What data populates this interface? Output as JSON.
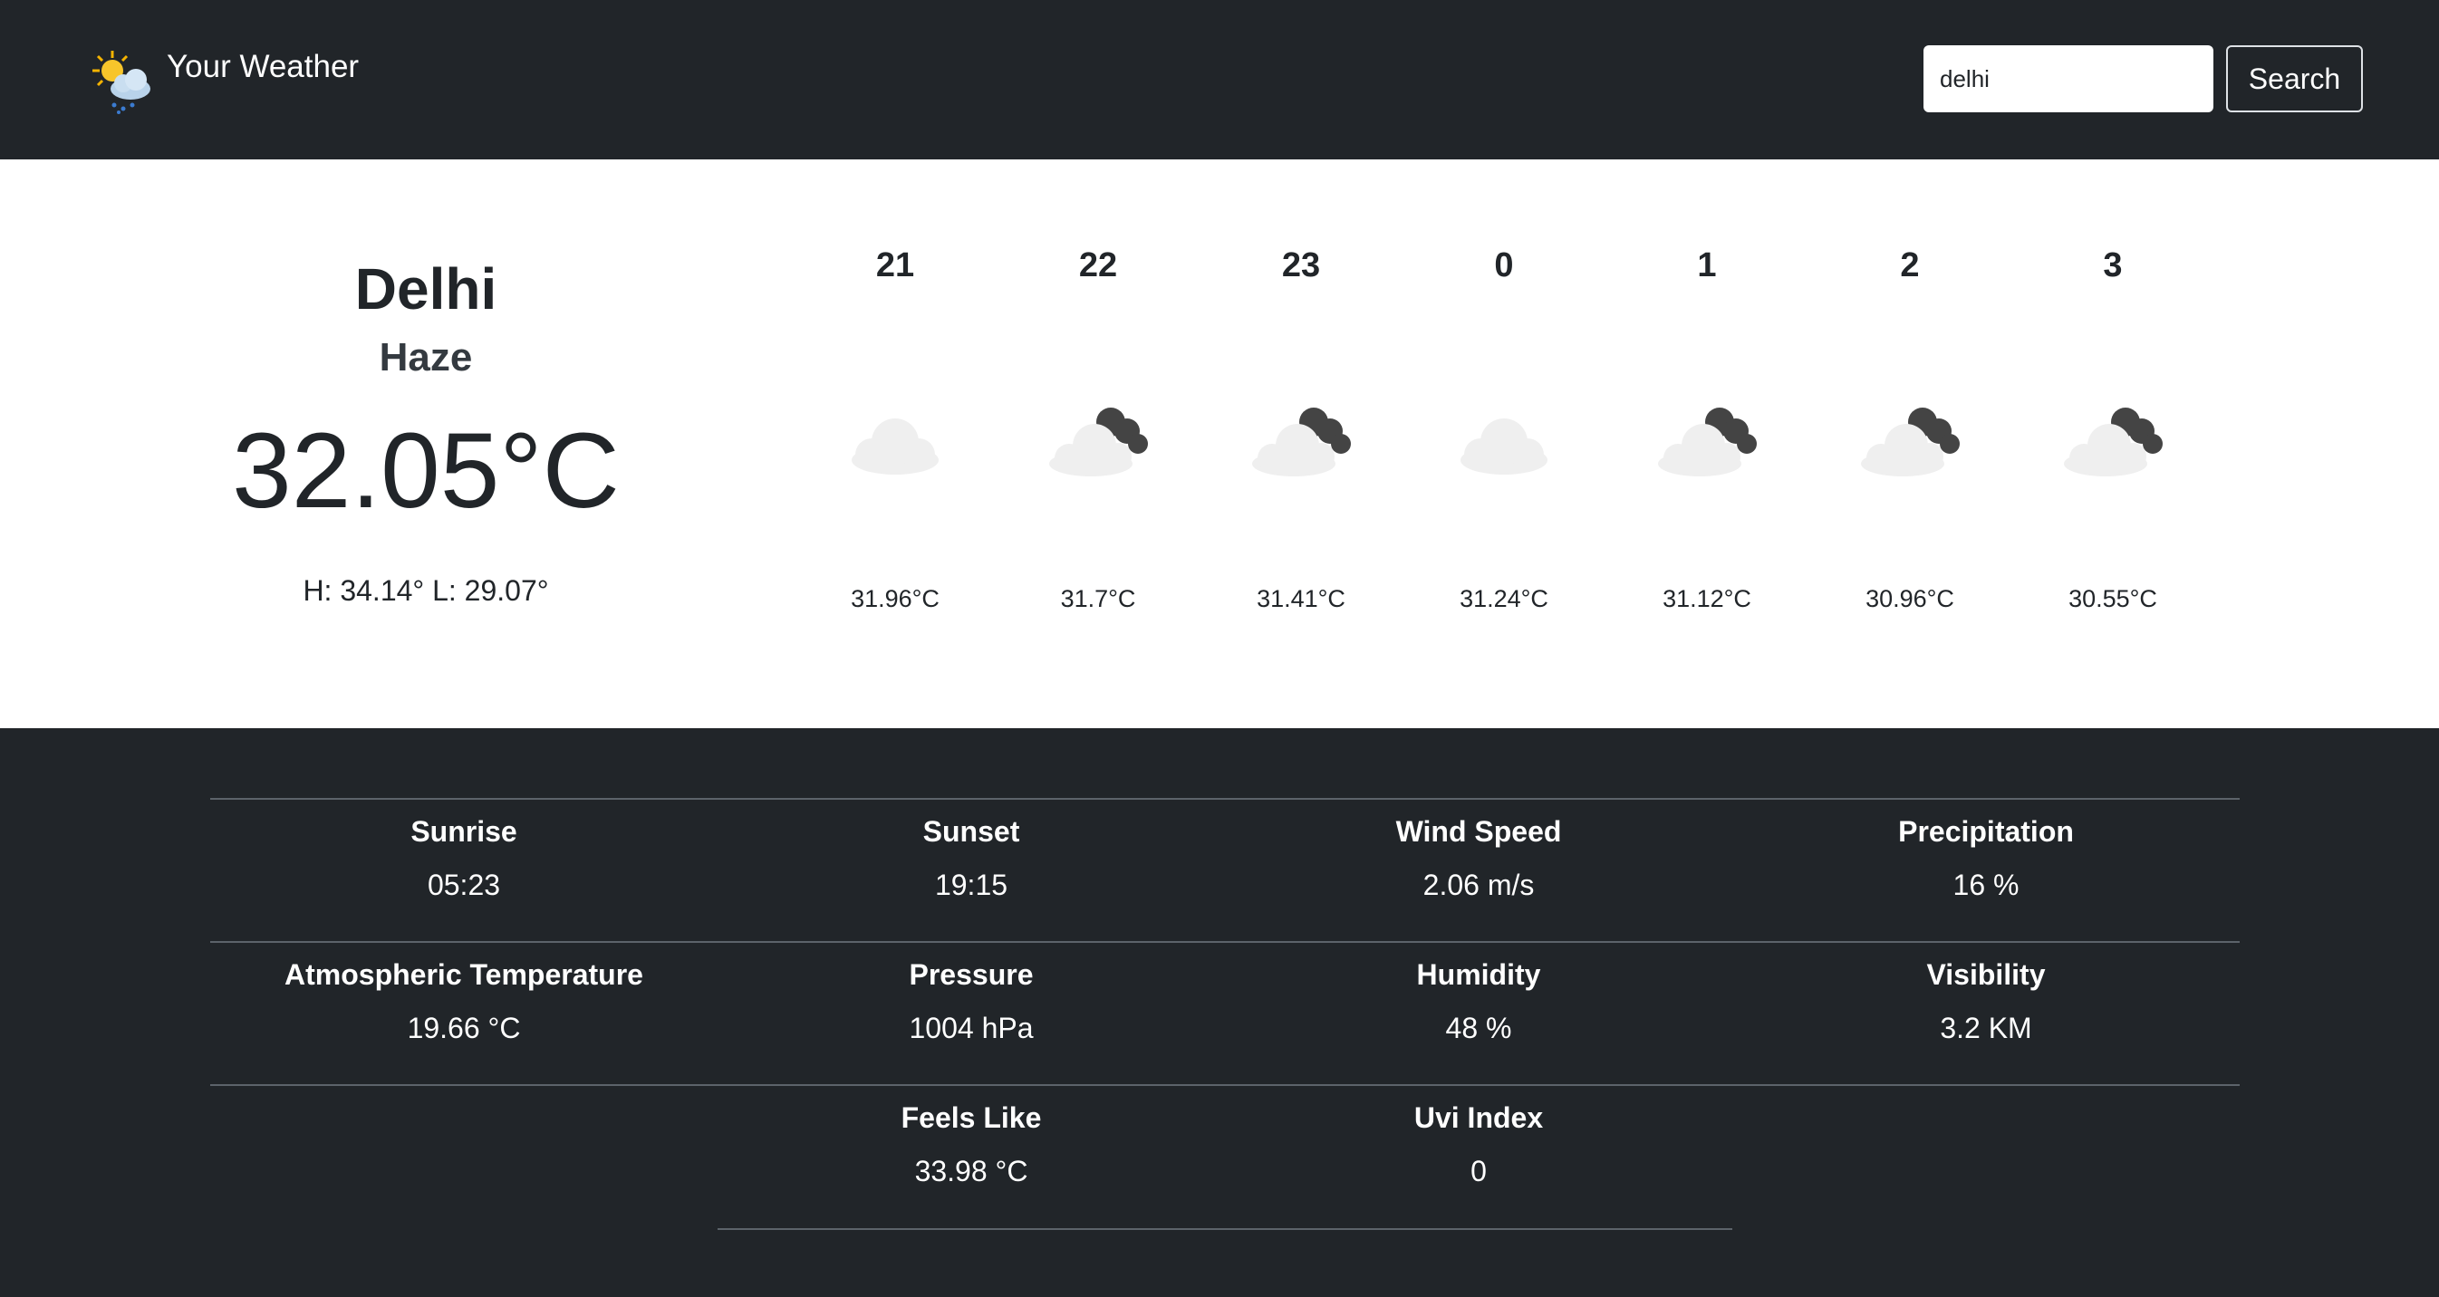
{
  "navbar": {
    "brand": "Your Weather",
    "search_value": "delhi",
    "search_button": "Search"
  },
  "current": {
    "city": "Delhi",
    "condition": "Haze",
    "temperature": "32.05°C",
    "high_low": "H: 34.14° L: 29.07°"
  },
  "forecast": [
    {
      "hour": "21",
      "temp": "31.96°C",
      "icon": "cloud-icon"
    },
    {
      "hour": "22",
      "temp": "31.7°C",
      "icon": "night-cloudy-icon"
    },
    {
      "hour": "23",
      "temp": "31.41°C",
      "icon": "night-cloudy-icon"
    },
    {
      "hour": "0",
      "temp": "31.24°C",
      "icon": "cloud-icon"
    },
    {
      "hour": "1",
      "temp": "31.12°C",
      "icon": "night-cloudy-icon"
    },
    {
      "hour": "2",
      "temp": "30.96°C",
      "icon": "night-cloudy-icon"
    },
    {
      "hour": "3",
      "temp": "30.55°C",
      "icon": "night-cloudy-icon"
    }
  ],
  "details": [
    {
      "label": "Sunrise",
      "value": "05:23"
    },
    {
      "label": "Sunset",
      "value": "19:15"
    },
    {
      "label": "Wind Speed",
      "value": "2.06 m/s"
    },
    {
      "label": "Precipitation",
      "value": "16 %"
    },
    {
      "label": "Atmospheric Temperature",
      "value": "19.66 °C"
    },
    {
      "label": "Pressure",
      "value": "1004 hPa"
    },
    {
      "label": "Humidity",
      "value": "48 %"
    },
    {
      "label": "Visibility",
      "value": "3.2 KM"
    },
    {
      "label": "Feels Like",
      "value": "33.98 °C"
    },
    {
      "label": "Uvi Index",
      "value": "0"
    }
  ],
  "colors": {
    "dark": "#212529",
    "light": "#ffffff",
    "divider": "#5c636a",
    "cloud_light": "#efefef",
    "cloud_dark": "#444444",
    "sun": "#f5b400"
  }
}
